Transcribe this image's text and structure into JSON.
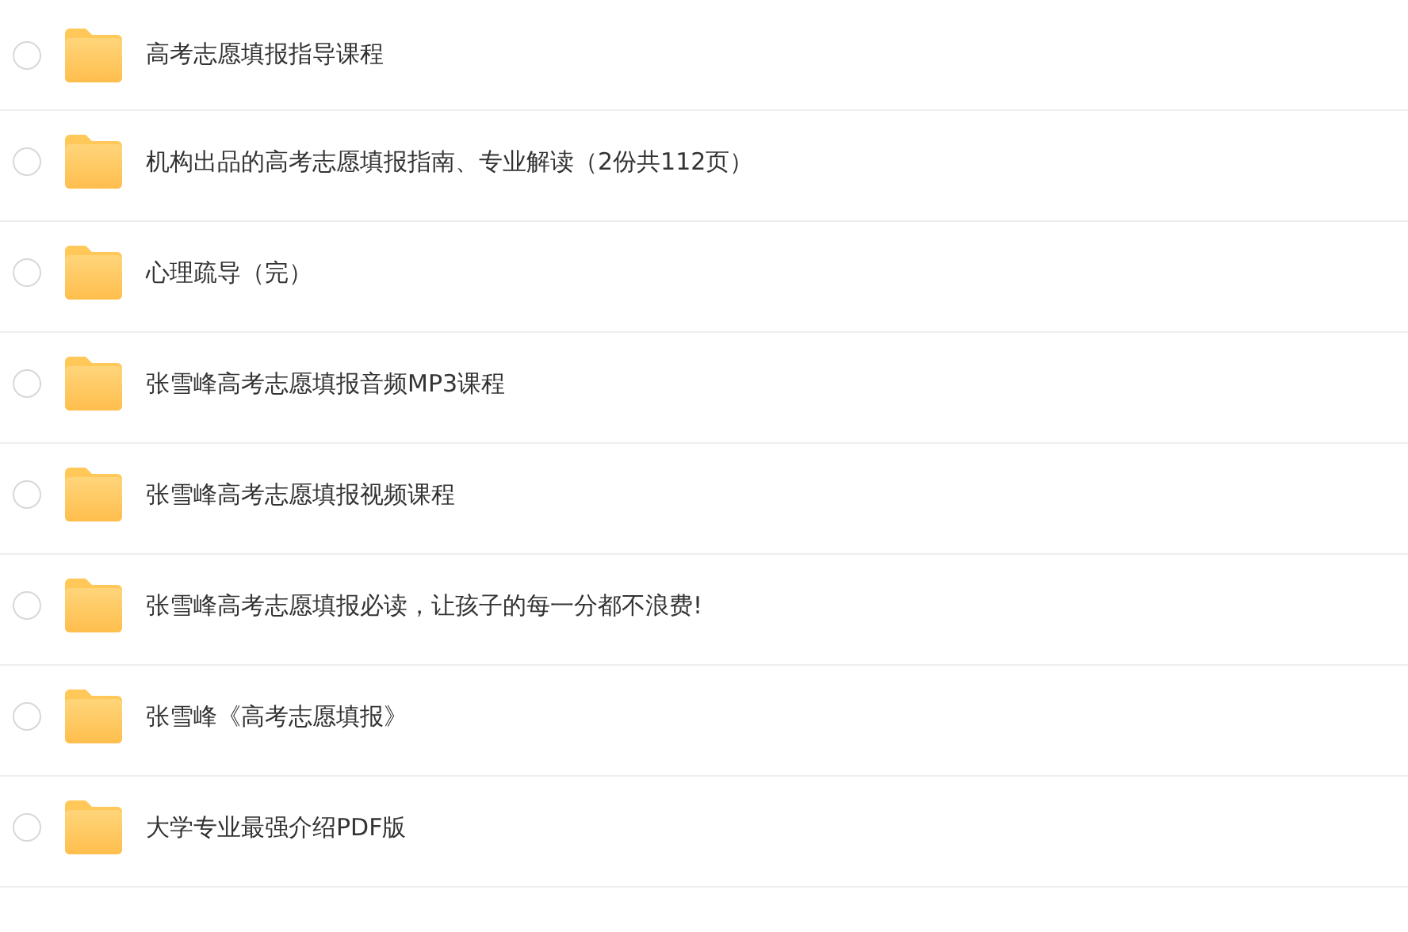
{
  "files": [
    {
      "name": "高考志愿填报指导课程",
      "checked": false
    },
    {
      "name": "机构出品的高考志愿填报指南、专业解读（2份共112页）",
      "checked": false
    },
    {
      "name": "心理疏导（完）",
      "checked": false
    },
    {
      "name": "张雪峰高考志愿填报音频MP3课程",
      "checked": false
    },
    {
      "name": "张雪峰高考志愿填报视频课程",
      "checked": false
    },
    {
      "name": "张雪峰高考志愿填报必读，让孩子的每一分都不浪费!",
      "checked": false
    },
    {
      "name": "张雪峰《高考志愿填报》",
      "checked": false
    },
    {
      "name": "大学专业最强介绍PDF版",
      "checked": false
    }
  ]
}
